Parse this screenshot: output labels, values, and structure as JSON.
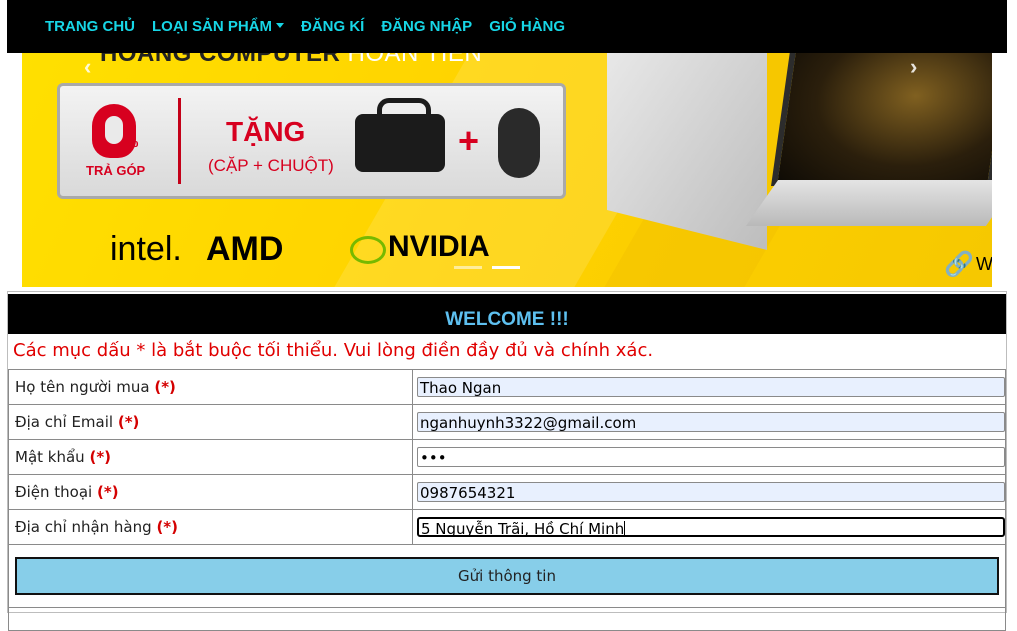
{
  "nav": {
    "items": [
      {
        "label": "TRANG CHỦ"
      },
      {
        "label": "LOẠI SẢN PHẨM",
        "dropdown": true
      },
      {
        "label": "ĐĂNG KÍ"
      },
      {
        "label": "ĐĂNG NHẬP"
      },
      {
        "label": "GIỎ HÀNG"
      }
    ]
  },
  "banner": {
    "headline_dark": "HOÀNG COMPUTER",
    "headline_light": "HOÀN TIỀN",
    "promo_zero": "0",
    "promo_percent": "%",
    "promo_installment": "TRẢ GÓP",
    "promo_gift": "TẶNG",
    "promo_gift_sub": "(CẶP + CHUỘT)",
    "promo_plus": "+",
    "brand_intel": "intel.",
    "brand_amd": "AMD",
    "brand_nvidia": "NVIDIA",
    "trailing_text": "W",
    "slide_count": 3,
    "active_slide": 2
  },
  "form": {
    "welcome": "WELCOME !!!",
    "notice": "Các mục dấu * là bắt buộc tối thiểu. Vui lòng điền đầy đủ và chính xác.",
    "required_mark": "(*)",
    "fields": [
      {
        "label": "Họ tên người mua",
        "value": "Thao Ngan",
        "autofilled": true
      },
      {
        "label": "Địa chỉ Email",
        "value": "nganhuynh3322@gmail.com",
        "autofilled": true
      },
      {
        "label": "Mật khẩu",
        "value": "•••",
        "autofilled": false
      },
      {
        "label": "Điện thoại",
        "value": "0987654321",
        "autofilled": true
      },
      {
        "label": "Địa chỉ nhận hàng",
        "value": "5 Nguyễn Trãi, Hồ Chí Minh",
        "autofilled": false,
        "focused": true
      }
    ],
    "submit_label": "Gửi thông tin"
  },
  "colors": {
    "nav_bg": "#000000",
    "nav_text": "#17d6e6",
    "welcome_text": "#5ec0f0",
    "notice_text": "#e00000",
    "required": "#d40000",
    "submit_bg": "#87cee9",
    "autofill_bg": "#e8f0fe",
    "banner_yellow": "#ffd200",
    "promo_red": "#d7001f"
  }
}
